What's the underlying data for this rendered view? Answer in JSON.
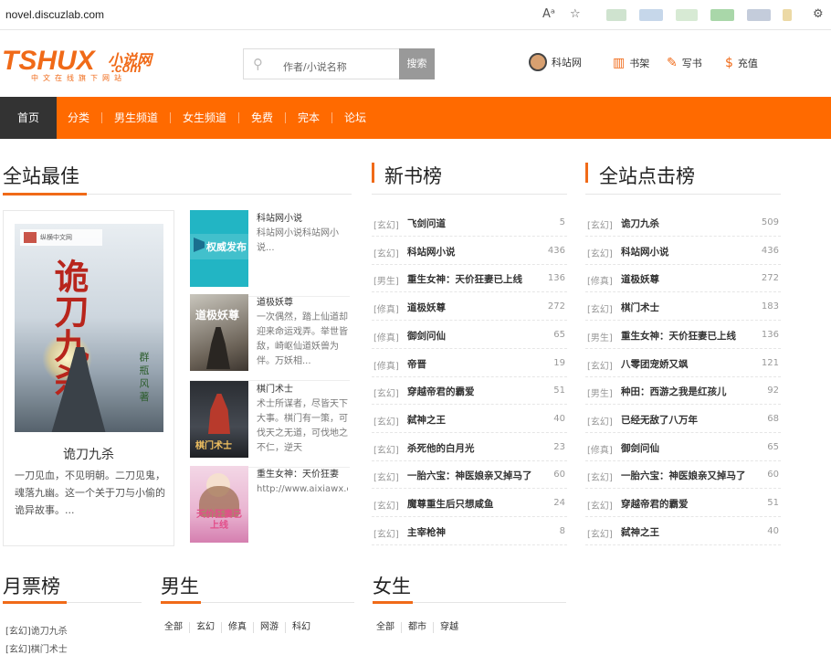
{
  "browser": {
    "url": "novel.discuzlab.com",
    "read_icon": "Aᵃ",
    "fav_icon": "☆"
  },
  "header": {
    "logo_main": "TSHUX",
    "logo_cn": "小说网",
    "logo_com": ".com",
    "logo_sub": "中文在线旗下网站",
    "search_placeholder": "作者/小说名称",
    "search_button": "搜索",
    "links": [
      {
        "label": "科站网",
        "icon": "avatar"
      },
      {
        "label": "书架",
        "icon": "bookshelf-icon"
      },
      {
        "label": "写书",
        "icon": "edit-icon"
      },
      {
        "label": "充值",
        "icon": "coin-icon"
      }
    ]
  },
  "nav": {
    "items": [
      "首页",
      "分类",
      "男生频道",
      "女生频道",
      "免费",
      "完本",
      "论坛"
    ],
    "active": "首页"
  },
  "best": {
    "title": "全站最佳",
    "feature": {
      "title": "诡刀九杀",
      "cover_title": "诡刀九杀",
      "cover_publisher": "纵横中文网",
      "cover_author": "群 瓶 风 著",
      "desc": "一刀见血，不见明朝。二刀见鬼，魂落九幽。这一个关于刀与小偷的诡异故事。..."
    },
    "books": [
      {
        "name": "科站网小说",
        "desc": "科站网小说科站网小说...",
        "cover_text": "权威发布"
      },
      {
        "name": "道极妖尊",
        "desc": "一次偶然，踏上仙道却迎来命运戏弄。举世皆敌，崎岖仙道妖兽为伴。万妖相...",
        "cover_text": "道极妖尊"
      },
      {
        "name": "棋门术士",
        "desc": "术士所谋者，尽皆天下大事。棋门有一策，可伐天之无道，可伐地之不仁，逆天",
        "cover_text": "棋门术士"
      },
      {
        "name": "重生女神：天价狂妻",
        "desc": "http://www.aixiawx.com/files/article/image...",
        "cover_text": "天价狂妻已上线"
      }
    ]
  },
  "newbooks": {
    "title": "新书榜",
    "rows": [
      {
        "cat": "[玄幻]",
        "name": "飞剑问道",
        "count": "5"
      },
      {
        "cat": "[玄幻]",
        "name": "科站网小说",
        "count": "436"
      },
      {
        "cat": "[男生]",
        "name": "重生女神：天价狂妻已上线",
        "count": "136"
      },
      {
        "cat": "[修真]",
        "name": "道极妖尊",
        "count": "272"
      },
      {
        "cat": "[修真]",
        "name": "御剑问仙",
        "count": "65"
      },
      {
        "cat": "[修真]",
        "name": "帝晋",
        "count": "19"
      },
      {
        "cat": "[玄幻]",
        "name": "穿越帝君的霸爱",
        "count": "51"
      },
      {
        "cat": "[玄幻]",
        "name": "弑神之王",
        "count": "40"
      },
      {
        "cat": "[玄幻]",
        "name": "杀死他的白月光",
        "count": "23"
      },
      {
        "cat": "[玄幻]",
        "name": "一胎六宝：神医娘亲又掉马了",
        "count": "60"
      },
      {
        "cat": "[玄幻]",
        "name": "魔尊重生后只想咸鱼",
        "count": "24"
      },
      {
        "cat": "[玄幻]",
        "name": "主宰枪神",
        "count": "8"
      }
    ]
  },
  "clicks": {
    "title": "全站点击榜",
    "rows": [
      {
        "cat": "[玄幻]",
        "name": "诡刀九杀",
        "count": "509"
      },
      {
        "cat": "[玄幻]",
        "name": "科站网小说",
        "count": "436"
      },
      {
        "cat": "[修真]",
        "name": "道极妖尊",
        "count": "272"
      },
      {
        "cat": "[玄幻]",
        "name": "棋门术士",
        "count": "183"
      },
      {
        "cat": "[男生]",
        "name": "重生女神：天价狂妻已上线",
        "count": "136"
      },
      {
        "cat": "[玄幻]",
        "name": "八零团宠娇又飒",
        "count": "121"
      },
      {
        "cat": "[男生]",
        "name": "种田：西游之我是红孩儿",
        "count": "92"
      },
      {
        "cat": "[玄幻]",
        "name": "已经无敌了八万年",
        "count": "68"
      },
      {
        "cat": "[修真]",
        "name": "御剑问仙",
        "count": "65"
      },
      {
        "cat": "[玄幻]",
        "name": "一胎六宝：神医娘亲又掉马了",
        "count": "60"
      },
      {
        "cat": "[玄幻]",
        "name": "穿越帝君的霸爱",
        "count": "51"
      },
      {
        "cat": "[玄幻]",
        "name": "弑神之王",
        "count": "40"
      }
    ]
  },
  "monthly": {
    "title": "月票榜",
    "rows": [
      "[玄幻]诡刀九杀",
      "[玄幻]棋门术士"
    ]
  },
  "male": {
    "title": "男生",
    "filters": [
      "全部",
      "玄幻",
      "修真",
      "网游",
      "科幻"
    ]
  },
  "female": {
    "title": "女生",
    "filters": [
      "全部",
      "都市",
      "穿越"
    ]
  },
  "colors": {
    "accent": "#ff6a00",
    "nav_active": "#333333"
  }
}
